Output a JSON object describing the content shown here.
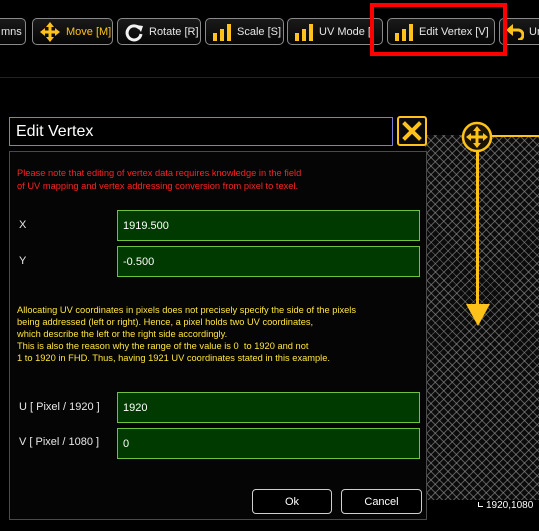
{
  "toolbar": {
    "columns_label": "mns",
    "move_label": "Move [M]",
    "rotate_label": "Rotate [R]",
    "scale_label": "Scale [S]",
    "uvmode_label": "UV Mode [",
    "editvertex_label": "Edit Vertex [V]",
    "undo_label": "Un",
    "active_color": "#ffc21a",
    "highlight_color": "#ff0000"
  },
  "dialog": {
    "title": "Edit Vertex",
    "warning_lines": [
      "Please note that editing of vertex data requires knowledge in the field",
      "of UV mapping and vertex addressing  conversion from pixel to texel."
    ],
    "x_label": "X",
    "x_value": "1919.500",
    "y_label": "Y",
    "y_value": "-0.500",
    "info_lines": [
      "Allocating UV coordinates in pixels does not precisely specify the side of the pixels",
      "being addressed (left or right). Hence, a pixel holds two UV coordinates,",
      "which describe the left or the right side accordingly.",
      "This is also the reason why the range of the value is 0  to 1920 and not",
      "1 to 1920 in FHD. Thus, having 1921 UV coordinates stated in this example."
    ],
    "u_label": "U [ Pixel / 1920 ]",
    "u_value": "1920",
    "v_label": "V [ Pixel / 1080 ]",
    "v_value": "0",
    "ok_label": "Ok",
    "cancel_label": "Cancel"
  },
  "canvas": {
    "corner_label": "1920,1080"
  }
}
